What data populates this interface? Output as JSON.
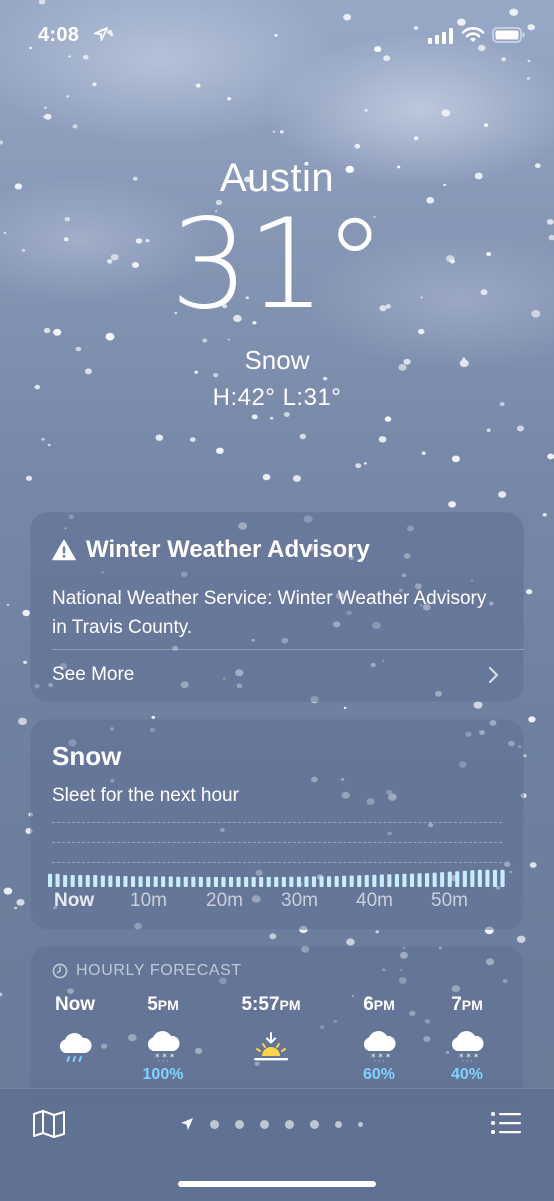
{
  "status_bar": {
    "time": "4:08",
    "icons": [
      "location-arrow-icon",
      "cellular-signal-icon",
      "wifi-icon",
      "battery-icon"
    ]
  },
  "current": {
    "city": "Austin",
    "temperature": "31°",
    "condition": "Snow",
    "hi_lo": "H:42°  L:31°"
  },
  "advisory": {
    "icon": "warning-triangle-icon",
    "title": "Winter Weather Advisory",
    "body": "National Weather Service: Winter Weather Advisory in Travis County.",
    "see_more": "See More"
  },
  "precipitation": {
    "title": "Snow",
    "subtitle": "Sleet for the next hour",
    "ticks": [
      "Now",
      "10m",
      "20m",
      "30m",
      "40m",
      "50m"
    ],
    "intensity": [
      0.55,
      0.55,
      0.5,
      0.5,
      0.5,
      0.5,
      0.5,
      0.48,
      0.48,
      0.46,
      0.46,
      0.45,
      0.45,
      0.45,
      0.44,
      0.44,
      0.44,
      0.43,
      0.43,
      0.43,
      0.42,
      0.42,
      0.42,
      0.42,
      0.42,
      0.42,
      0.42,
      0.42,
      0.42,
      0.42,
      0.42,
      0.42,
      0.43,
      0.43,
      0.44,
      0.44,
      0.45,
      0.45,
      0.46,
      0.47,
      0.48,
      0.49,
      0.5,
      0.51,
      0.52,
      0.53,
      0.54,
      0.55,
      0.56,
      0.57,
      0.58,
      0.6,
      0.62,
      0.64,
      0.66,
      0.68,
      0.7,
      0.72,
      0.72,
      0.72,
      0.72
    ],
    "bar_color": "#c9ecff"
  },
  "hourly": {
    "header": "HOURLY FORECAST",
    "header_icon": "clock-icon",
    "items": [
      {
        "time": "Now",
        "suffix": "",
        "icon": "cloud-rain-icon",
        "pct": ""
      },
      {
        "time": "5",
        "suffix": "PM",
        "icon": "cloud-snow-icon",
        "pct": "100%"
      },
      {
        "time": "5:57",
        "suffix": "PM",
        "icon": "sunset-icon",
        "pct": ""
      },
      {
        "time": "6",
        "suffix": "PM",
        "icon": "cloud-snow-icon",
        "pct": "60%"
      },
      {
        "time": "7",
        "suffix": "PM",
        "icon": "cloud-snow-icon",
        "pct": "40%"
      }
    ]
  },
  "tab_bar": {
    "left_icon": "map-icon",
    "right_icon": "list-icon",
    "page_count": 7,
    "current_page": 0
  },
  "colors": {
    "precip_accent": "#7fd3ff",
    "sun": "#ffd34a"
  }
}
